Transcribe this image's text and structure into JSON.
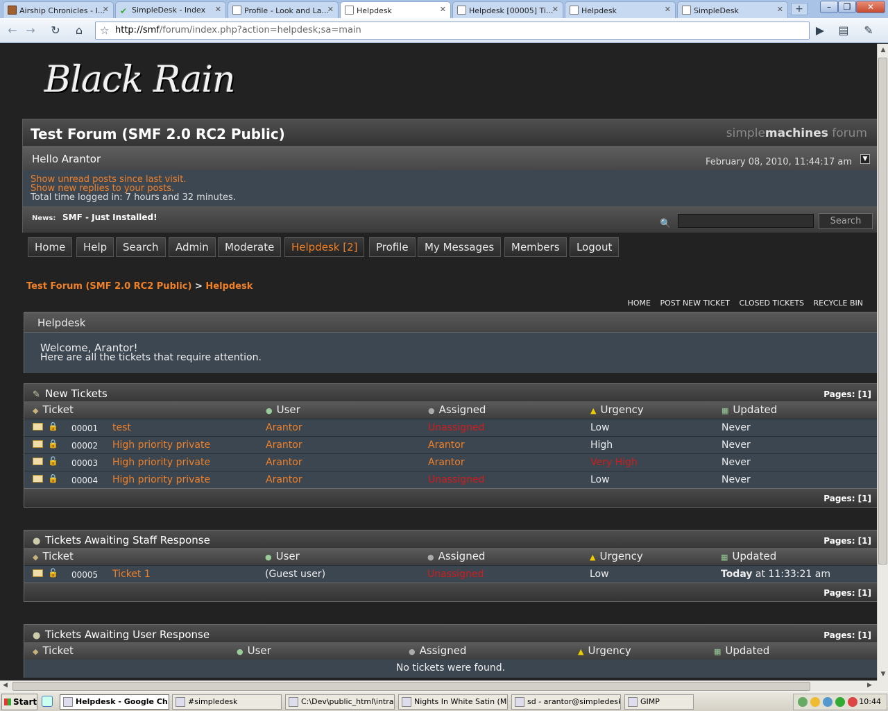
{
  "browser": {
    "tabs": [
      {
        "label": "Airship Chronicles - I...",
        "icon": "book-icon",
        "active": false
      },
      {
        "label": "SimpleDesk - Index",
        "icon": "check-icon",
        "active": false
      },
      {
        "label": "Profile - Look and La...",
        "icon": "page-icon",
        "active": false
      },
      {
        "label": "Helpdesk",
        "icon": "page-icon",
        "active": true
      },
      {
        "label": "Helpdesk [00005] Ti...",
        "icon": "page-icon",
        "active": false
      },
      {
        "label": "Helpdesk",
        "icon": "page-icon",
        "active": false
      },
      {
        "label": "SimpleDesk",
        "icon": "page-icon",
        "active": false
      }
    ],
    "url_host": "http://smf",
    "url_rest": "/forum/index.php?action=helpdesk;sa=main"
  },
  "forum": {
    "logo_text": "Black Rain",
    "title": "Test Forum (SMF 2.0 RC2 Public)",
    "smf_logo_light": "simple",
    "smf_logo_bold": "machines",
    "smf_logo_tail": " forum",
    "hello_prefix": "Hello ",
    "username": "Arantor",
    "datetime": "February 08, 2010, 11:44:17 am",
    "unread_link": "Show unread posts since last visit.",
    "replies_link": "Show new replies to your posts.",
    "time_logged": "Total time logged in: 7 hours and 32 minutes.",
    "news_label": "News:",
    "news_text": "SMF - Just Installed!",
    "search_button": "Search"
  },
  "menu": [
    {
      "label": "Home",
      "active": false
    },
    {
      "label": "Help",
      "active": false
    },
    {
      "label": "Search",
      "active": false
    },
    {
      "label": "Admin",
      "active": false
    },
    {
      "label": "Moderate",
      "active": false
    },
    {
      "label": "Helpdesk [2]",
      "active": true
    },
    {
      "label": "Profile",
      "active": false
    },
    {
      "label": "My Messages",
      "active": false
    },
    {
      "label": "Members",
      "active": false
    },
    {
      "label": "Logout",
      "active": false
    }
  ],
  "breadcrumb": {
    "forum": "Test Forum (SMF 2.0 RC2 Public)",
    "sep": " > ",
    "current": "Helpdesk"
  },
  "helpdesk_nav": [
    "HOME",
    "POST NEW TICKET",
    "CLOSED TICKETS",
    "RECYCLE BIN"
  ],
  "helpdesk": {
    "title": "Helpdesk",
    "welcome": "Welcome, Arantor!",
    "welcome_sub": "Here are all the tickets that require attention."
  },
  "columns": {
    "ticket": "Ticket",
    "user": "User",
    "assigned": "Assigned",
    "urgency": "Urgency",
    "updated": "Updated"
  },
  "pages_label": "Pages: [1]",
  "new_tickets": {
    "title": "New Tickets",
    "rows": [
      {
        "id": "00001",
        "subject": "test",
        "user": "Arantor",
        "assigned": "Unassigned",
        "urgency": "Low",
        "updated": "Never"
      },
      {
        "id": "00002",
        "subject": "High priority private",
        "user": "Arantor",
        "assigned": "Arantor",
        "urgency": "High",
        "updated": "Never"
      },
      {
        "id": "00003",
        "subject": "High priority private",
        "user": "Arantor",
        "assigned": "Arantor",
        "urgency": "Very High",
        "updated": "Never"
      },
      {
        "id": "00004",
        "subject": "High priority private",
        "user": "Arantor",
        "assigned": "Unassigned",
        "urgency": "Low",
        "updated": "Never"
      }
    ]
  },
  "staff_tickets": {
    "title": "Tickets Awaiting Staff Response",
    "rows": [
      {
        "id": "00005",
        "subject": "Ticket 1",
        "user": "(Guest user)",
        "assigned": "Unassigned",
        "urgency": "Low",
        "updated_bold": "Today",
        "updated_rest": " at 11:33:21 am"
      }
    ]
  },
  "user_tickets": {
    "title": "Tickets Awaiting User Response",
    "empty": "No tickets were found."
  },
  "taskbar": {
    "start": "Start",
    "tasks": [
      {
        "label": "Helpdesk - Google Ch...",
        "active": true
      },
      {
        "label": "#simpledesk",
        "active": false
      },
      {
        "label": "C:\\Dev\\public_html\\intra...",
        "active": false
      },
      {
        "label": "Nights In White Satin (M...",
        "active": false
      },
      {
        "label": "sd - arantor@simpledesk...",
        "active": false
      },
      {
        "label": "GIMP",
        "active": false
      }
    ],
    "clock": "10:44"
  }
}
